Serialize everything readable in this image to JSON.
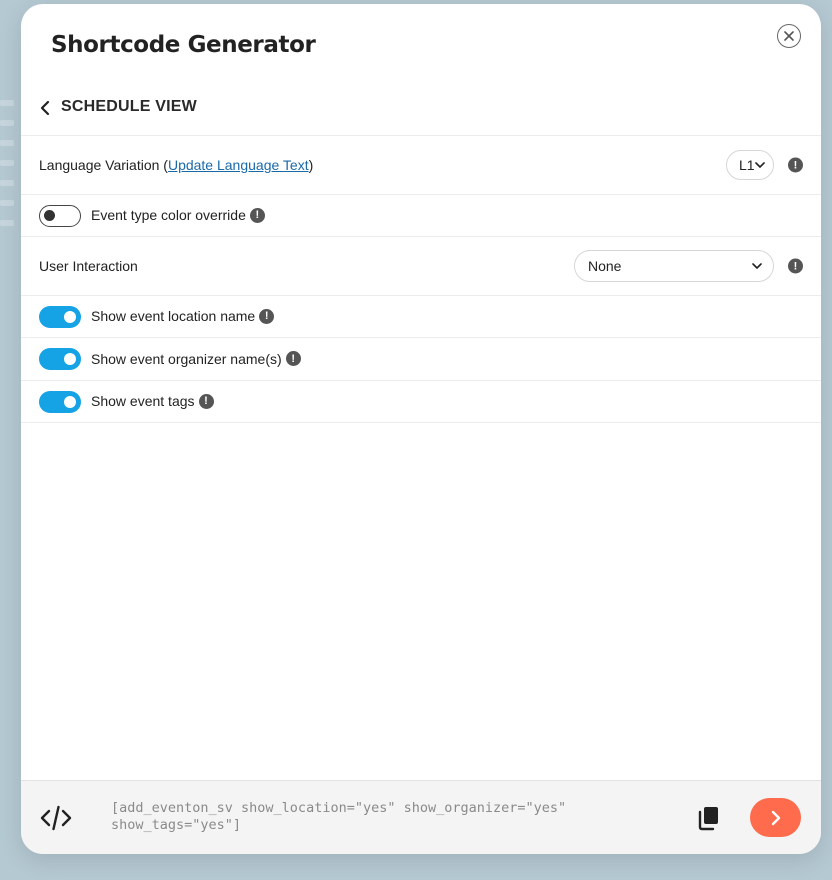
{
  "modal": {
    "title": "Shortcode Generator",
    "section_title": "SCHEDULE VIEW"
  },
  "language": {
    "label_prefix": "Language Variation (",
    "link_text": "Update Language Text",
    "label_suffix": ")",
    "selected": "L1"
  },
  "event_type_override": {
    "label": "Event type color override",
    "enabled": false
  },
  "user_interaction": {
    "label": "User Interaction",
    "selected": "None"
  },
  "toggles": [
    {
      "label": "Show event location name",
      "enabled": true
    },
    {
      "label": "Show event organizer name(s)",
      "enabled": true
    },
    {
      "label": "Show event tags",
      "enabled": true
    }
  ],
  "info_glyph": "!",
  "footer": {
    "shortcode": "[add_eventon_sv show_location=\"yes\" show_organizer=\"yes\"\nshow_tags=\"yes\"]"
  },
  "colors": {
    "accent_toggle": "#15a3e6",
    "go_button": "#fe6b4d",
    "link": "#1a6aa8"
  },
  "icons": {
    "close": "close-icon",
    "back": "chevron-left-icon",
    "info": "info-icon",
    "dropdown": "chevron-down-icon",
    "code": "code-icon",
    "copy": "copy-icon",
    "go": "chevron-right-icon"
  }
}
